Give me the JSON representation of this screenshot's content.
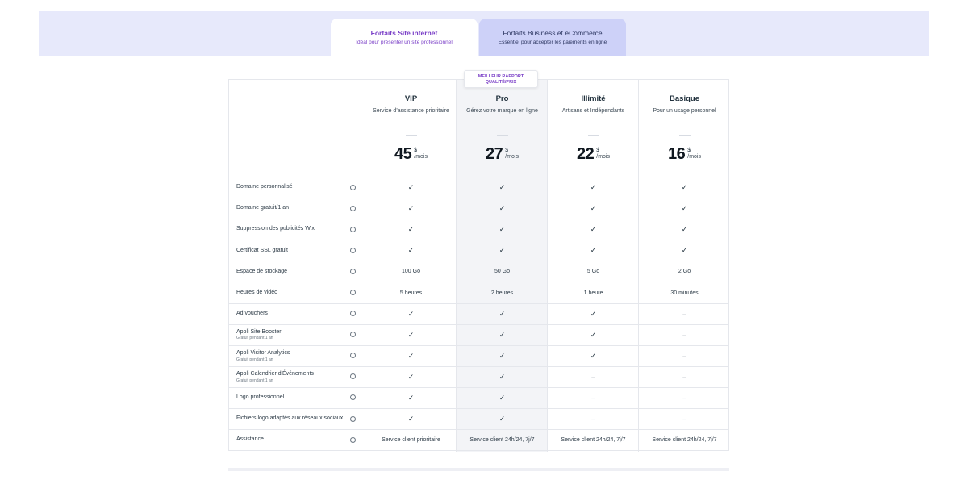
{
  "tabs": [
    {
      "title": "Forfaits Site internet",
      "subtitle": "Idéal pour présenter un site professionnel",
      "active": true
    },
    {
      "title": "Forfaits Business et eCommerce",
      "subtitle": "Essentiel pour accepter les paiements en ligne",
      "active": false
    }
  ],
  "badge": {
    "line1": "MEILLEUR RAPPORT",
    "line2": "QUALITÉ/PRIX"
  },
  "plans": [
    {
      "name": "VIP",
      "desc": "Service d'assistance prioritaire",
      "price": "45",
      "currency": "$",
      "period": "/mois"
    },
    {
      "name": "Pro",
      "desc": "Gérez votre marque en ligne",
      "price": "27",
      "currency": "$",
      "period": "/mois"
    },
    {
      "name": "Illimité",
      "desc": "Artisans et Indépendants",
      "price": "22",
      "currency": "$",
      "period": "/mois"
    },
    {
      "name": "Basique",
      "desc": "Pour un usage personnel",
      "price": "16",
      "currency": "$",
      "period": "/mois"
    }
  ],
  "info_icon": "i",
  "check_glyph": "✓",
  "dash_glyph": "–",
  "features": [
    {
      "label": "Domaine personnalisé",
      "sub": "",
      "values": [
        "check",
        "check",
        "check",
        "check"
      ]
    },
    {
      "label": "Domaine gratuit/1 an",
      "sub": "",
      "values": [
        "check",
        "check",
        "check",
        "check"
      ]
    },
    {
      "label": "Suppression des publicités Wix",
      "sub": "",
      "values": [
        "check",
        "check",
        "check",
        "check"
      ]
    },
    {
      "label": "Certificat SSL gratuit",
      "sub": "",
      "values": [
        "check",
        "check",
        "check",
        "check"
      ]
    },
    {
      "label": "Espace de stockage",
      "sub": "",
      "values": [
        "100 Go",
        "50 Go",
        "5 Go",
        "2 Go"
      ]
    },
    {
      "label": "Heures de vidéo",
      "sub": "",
      "values": [
        "5 heures",
        "2 heures",
        "1 heure",
        "30 minutes"
      ]
    },
    {
      "label": "Ad vouchers",
      "sub": "",
      "values": [
        "check",
        "check",
        "check",
        "dash"
      ]
    },
    {
      "label": "Appli Site Booster",
      "sub": "Gratuit pendant 1 an",
      "values": [
        "check",
        "check",
        "check",
        "dash"
      ]
    },
    {
      "label": "Appli Visitor Analytics",
      "sub": "Gratuit pendant 1 an",
      "values": [
        "check",
        "check",
        "check",
        "dash"
      ]
    },
    {
      "label": "Appli Calendrier d'Événements",
      "sub": "Gratuit pendant 1 an",
      "values": [
        "check",
        "check",
        "dash",
        "dash"
      ]
    },
    {
      "label": "Logo professionnel",
      "sub": "",
      "values": [
        "check",
        "check",
        "dash",
        "dash"
      ]
    },
    {
      "label": "Fichiers logo adaptés aux réseaux sociaux",
      "sub": "",
      "values": [
        "check",
        "check",
        "dash",
        "dash"
      ]
    },
    {
      "label": "Assistance",
      "sub": "",
      "values": [
        "Service client prioritaire",
        "Service client 24h/24, 7j/7",
        "Service client 24h/24, 7j/7",
        "Service client 24h/24, 7j/7"
      ]
    }
  ],
  "colors": {
    "accent": "#7a3fc7",
    "tab_band": "#e7e9fb",
    "tab_inactive": "#cdd1f8",
    "pro_column": "#f3f4f7"
  }
}
